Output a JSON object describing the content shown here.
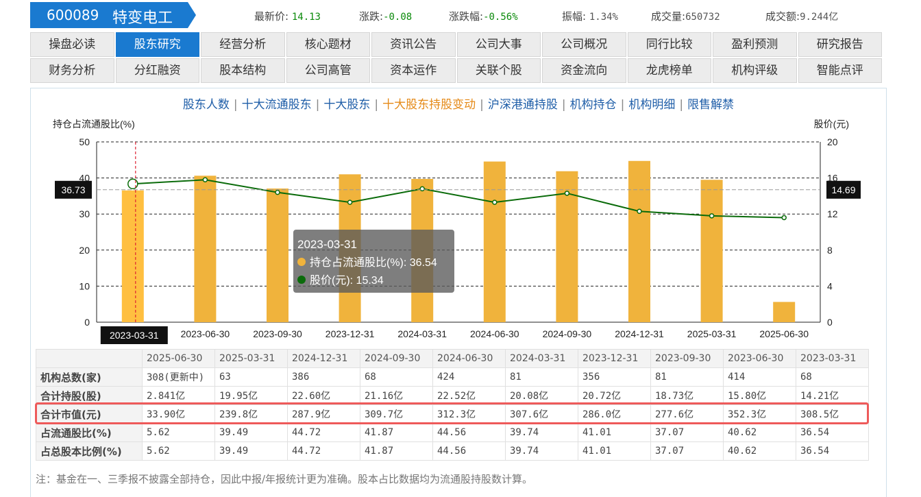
{
  "stock": {
    "code": "600089",
    "name": "特变电工"
  },
  "quote": {
    "latest_label": "最新价:",
    "latest": "14.13",
    "change_label": "涨跌:",
    "change": "-0.08",
    "pct_label": "涨跌幅:",
    "pct": "-0.56%",
    "amp_label": "振幅:",
    "amp": "1.34%",
    "vol_label": "成交量:",
    "vol": "650732",
    "amt_label": "成交额:",
    "amt": "9.244亿"
  },
  "nav": {
    "row1": [
      "操盘必读",
      "股东研究",
      "经营分析",
      "核心题材",
      "资讯公告",
      "公司大事",
      "公司概况",
      "同行比较",
      "盈利预测",
      "研究报告"
    ],
    "row2": [
      "财务分析",
      "分红融资",
      "股本结构",
      "公司高管",
      "资本运作",
      "关联个股",
      "资金流向",
      "龙虎榜单",
      "机构评级",
      "智能点评"
    ],
    "active": "股东研究"
  },
  "subnav": {
    "items": [
      "股东人数",
      "十大流通股东",
      "十大股东",
      "十大股东持股变动",
      "沪深港通持股",
      "机构持仓",
      "机构明细",
      "限售解禁"
    ],
    "active": "十大股东持股变动"
  },
  "chart_data": {
    "type": "bar",
    "left_axis_label": "持仓占流通股比(%)",
    "right_axis_label": "股价(元)",
    "categories": [
      "2023-03-31",
      "2023-06-30",
      "2023-09-30",
      "2023-12-31",
      "2024-03-31",
      "2024-06-30",
      "2024-09-30",
      "2024-12-31",
      "2025-03-31",
      "2025-06-30"
    ],
    "series": [
      {
        "name": "持仓占流通股比(%)",
        "axis": "left",
        "color": "#f0b33c",
        "values": [
          36.54,
          40.62,
          37.07,
          41.01,
          39.74,
          44.56,
          41.87,
          44.72,
          39.49,
          5.62
        ]
      },
      {
        "name": "股价(元)",
        "axis": "right",
        "color": "#0a6b0a",
        "values": [
          15.34,
          15.8,
          14.4,
          13.3,
          14.8,
          13.3,
          14.3,
          12.3,
          11.8,
          11.6
        ]
      }
    ],
    "left_ylim": [
      0,
      50
    ],
    "left_ticks": [
      0,
      10,
      20,
      30,
      40,
      50
    ],
    "right_ylim": [
      0,
      20
    ],
    "right_ticks": [
      0,
      4,
      8,
      12,
      16,
      20
    ],
    "cursor_left_value": "36.73",
    "cursor_right_value": "14.69",
    "cursor_category": "2023-03-31",
    "tooltip": {
      "title": "2023-03-31",
      "line1_label": "持仓占流通股比(%): ",
      "line1_value": "36.54",
      "line2_label": "股价(元): ",
      "line2_value": "15.34"
    }
  },
  "table": {
    "headers": [
      "2025-06-30",
      "2025-03-31",
      "2024-12-31",
      "2024-09-30",
      "2024-06-30",
      "2024-03-31",
      "2023-12-31",
      "2023-09-30",
      "2023-06-30",
      "2023-03-31"
    ],
    "rows": [
      {
        "label": "机构总数(家)",
        "values": [
          "308(更新中)",
          "63",
          "386",
          "68",
          "424",
          "81",
          "356",
          "81",
          "414",
          "68"
        ]
      },
      {
        "label": "合计持股(股)",
        "values": [
          "2.841亿",
          "19.95亿",
          "22.60亿",
          "21.16亿",
          "22.52亿",
          "20.08亿",
          "20.72亿",
          "18.73亿",
          "15.80亿",
          "14.21亿"
        ]
      },
      {
        "label": "合计市值(元)",
        "values": [
          "33.90亿",
          "239.8亿",
          "287.9亿",
          "309.7亿",
          "312.3亿",
          "307.6亿",
          "286.0亿",
          "277.6亿",
          "352.3亿",
          "308.5亿"
        ]
      },
      {
        "label": "占流通股比(%)",
        "values": [
          "5.62",
          "39.49",
          "44.72",
          "41.87",
          "44.56",
          "39.74",
          "41.01",
          "37.07",
          "40.62",
          "36.54"
        ]
      },
      {
        "label": "占总股本比例(%)",
        "values": [
          "5.62",
          "39.49",
          "44.72",
          "41.87",
          "44.56",
          "39.74",
          "41.01",
          "37.07",
          "40.62",
          "36.54"
        ]
      }
    ]
  },
  "note": "注：基金在一、三季报不披露全部持仓，因此中报/年报统计更为准确。股本占比数据均为流通股持股数计算。",
  "colors": {
    "brand": "#1a7ad0",
    "bar": "#f0b33c",
    "line": "#0a6b0a",
    "highlight": "#ee5a5a"
  }
}
